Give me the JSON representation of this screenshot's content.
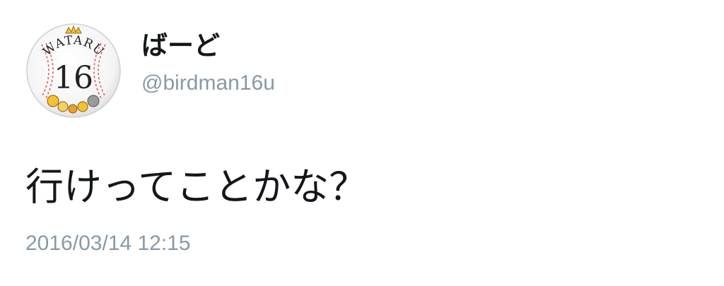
{
  "tweet": {
    "user": {
      "display_name": "ばーど",
      "handle": "@birdman16u",
      "avatar": {
        "icon": "baseball-badge-avatar",
        "arc_text": "WATARU",
        "number": "16"
      }
    },
    "text": "行けってことかな？",
    "timestamp": "2016/03/14 12:15"
  },
  "colors": {
    "primary_text": "#14171a",
    "secondary_text": "#8899a6",
    "background": "#ffffff",
    "stitch_red": "#e05a5a"
  }
}
